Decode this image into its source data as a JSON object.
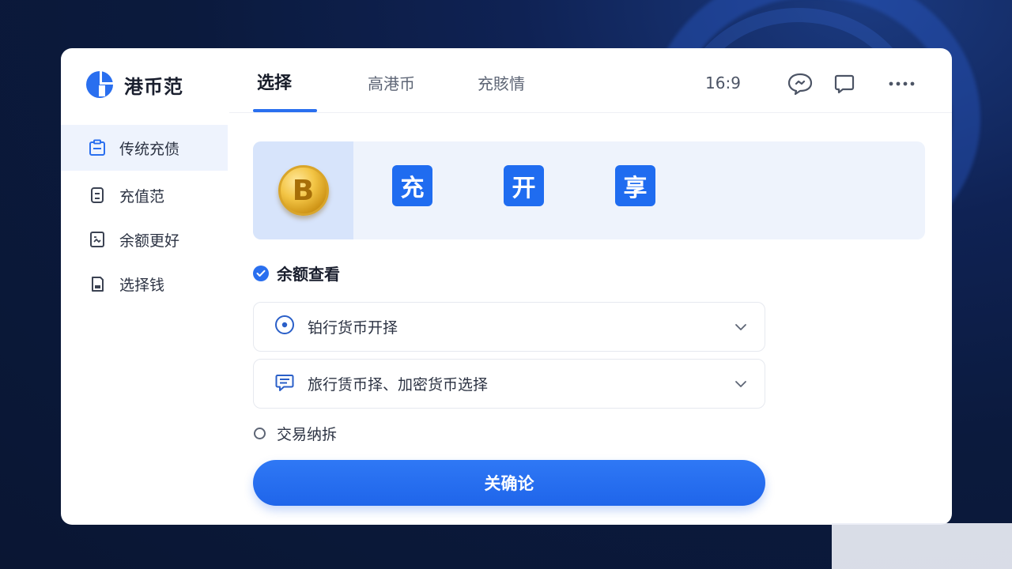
{
  "app": {
    "name": "港币范",
    "logo_icon": "brand-logo-icon"
  },
  "tabs": [
    {
      "label": "选择",
      "active": true
    },
    {
      "label": "高港币",
      "active": false
    },
    {
      "label": "充賅情",
      "active": false
    }
  ],
  "header": {
    "ratio": "16:9",
    "icons": [
      "chat-bubble-icon",
      "message-square-icon",
      "more-icon"
    ]
  },
  "sidebar": {
    "items": [
      {
        "label": "传统充债",
        "icon": "clipboard-icon",
        "active": true
      },
      {
        "label": "充值范",
        "icon": "device-icon",
        "active": false
      },
      {
        "label": "余额更好",
        "icon": "chart-doc-icon",
        "active": false
      },
      {
        "label": "选择钱",
        "icon": "wallet-doc-icon",
        "active": false
      }
    ]
  },
  "banner": {
    "coin_symbol": "B",
    "coin_icon": "bitcoin-coin-icon",
    "tiles": [
      "充",
      "开",
      "享"
    ]
  },
  "section": {
    "title": "余额查看",
    "checked": true,
    "selects": [
      {
        "label": "铂行货币开择",
        "icon": "target-circle-icon"
      },
      {
        "label": "旅行赁币择、加密货币选择",
        "icon": "chat-lines-icon"
      }
    ],
    "radio_label": "交易纳拆",
    "radio_checked": false
  },
  "confirm_label": "关确论",
  "colors": {
    "accent": "#2a6fef",
    "background": "#0b1a3d",
    "window": "#ffffff"
  }
}
